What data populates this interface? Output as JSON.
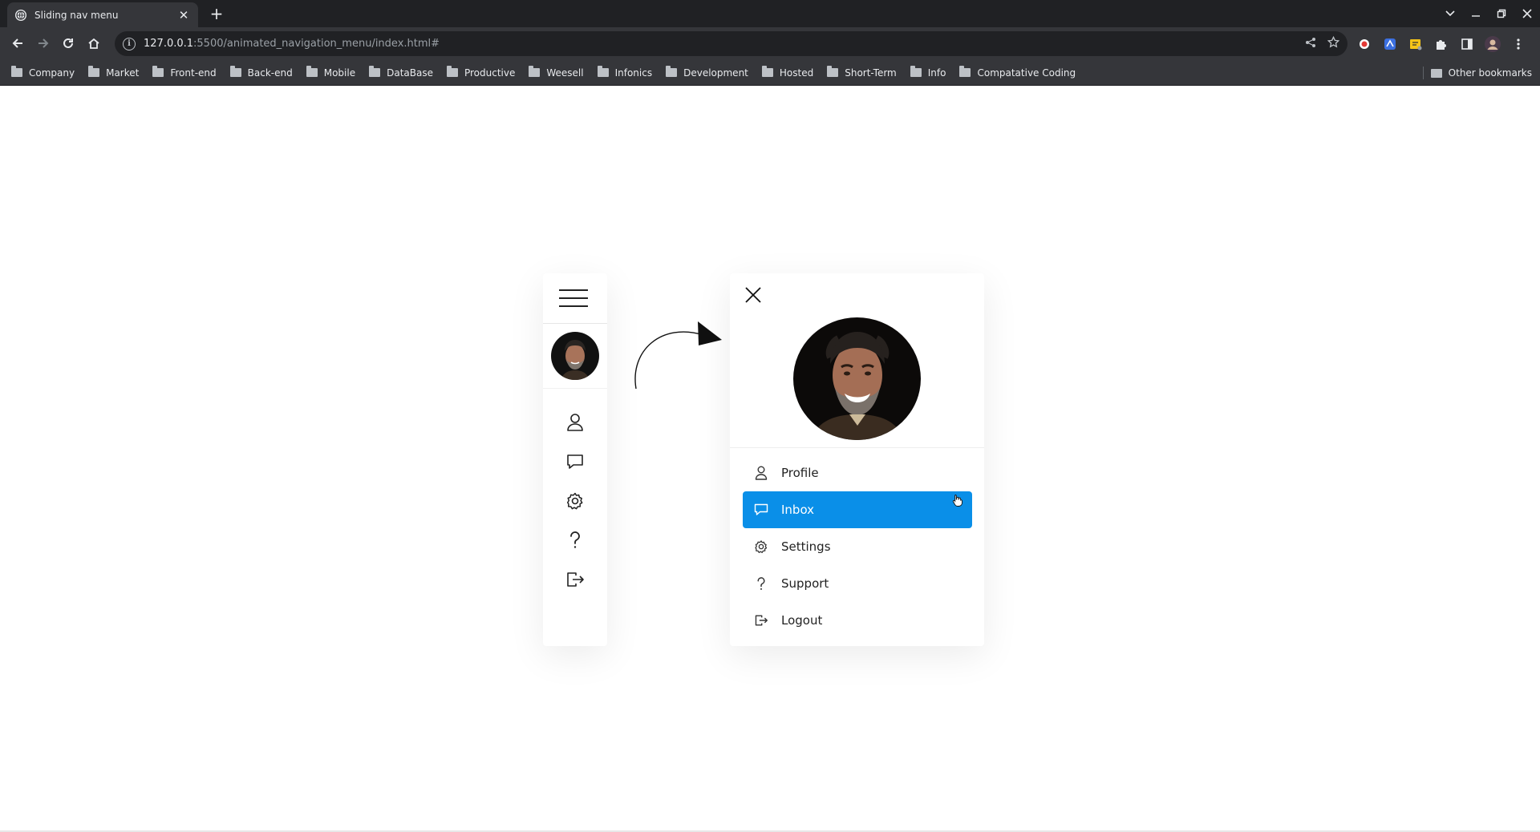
{
  "browser": {
    "tab_title": "Sliding nav menu",
    "url_host": "127.0.0.1",
    "url_path": ":5500/animated_navigation_menu/index.html#",
    "bookmarks": [
      "Company",
      "Market",
      "Front-end",
      "Back-end",
      "Mobile",
      "DataBase",
      "Productive",
      "Weesell",
      "Infonics",
      "Development",
      "Hosted",
      "Short-Term",
      "Info",
      "Compatative Coding"
    ],
    "other_bookmarks": "Other bookmarks"
  },
  "rail": {
    "icons": [
      "user-icon",
      "message-icon",
      "gear-icon",
      "question-icon",
      "logout-icon"
    ]
  },
  "menu": {
    "items": [
      {
        "label": "Profile",
        "icon": "user-icon"
      },
      {
        "label": "Inbox",
        "icon": "message-icon",
        "active": true
      },
      {
        "label": "Settings",
        "icon": "gear-icon"
      },
      {
        "label": "Support",
        "icon": "question-icon"
      },
      {
        "label": "Logout",
        "icon": "logout-icon"
      }
    ]
  },
  "colors": {
    "accent": "#0a8fe8",
    "chrome_dark": "#202124",
    "chrome_mid": "#35363a"
  }
}
